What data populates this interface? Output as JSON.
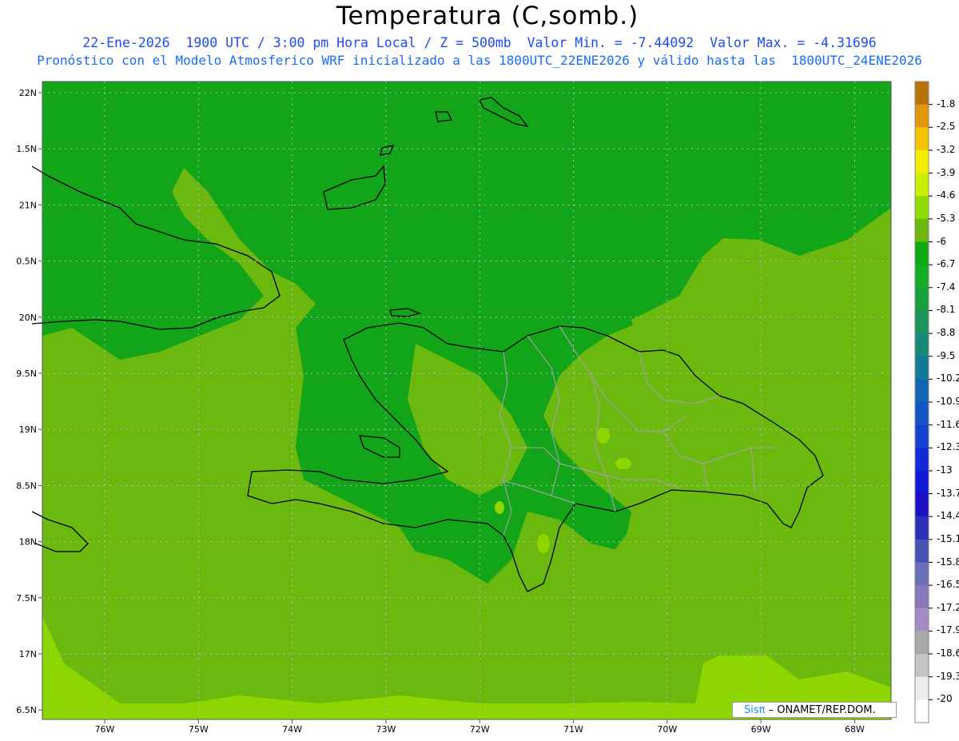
{
  "header": {
    "title": "Temperatura (C,somb.)",
    "subtitle_line1": "22-Ene-2026  1900 UTC / 3:00 pm Hora Local / Z = 500mb  Valor Min. = -7.44092  Valor Max. = -4.31696",
    "subtitle_line2": "Pronóstico con el Modelo Atmosferico WRF inicializado a las 1800UTC_22ENE2026 y válido hasta las  1800UTC_24ENE2026"
  },
  "axes": {
    "lon_labels": [
      "76W",
      "75W",
      "74W",
      "73W",
      "72W",
      "71W",
      "70W",
      "69W",
      "68W"
    ],
    "lat_labels": [
      "22N",
      "1.5N",
      "21N",
      "0.5N",
      "20N",
      "9.5N",
      "19N",
      "8.5N",
      "18N",
      "7.5N",
      "17N",
      "6.5N"
    ]
  },
  "colorbar": {
    "labels": [
      "-1.8",
      "-2.5",
      "-3.2",
      "-3.9",
      "-4.6",
      "-5.3",
      "-6",
      "-6.7",
      "-7.4",
      "-8.1",
      "-8.8",
      "-9.5",
      "-10.2",
      "-10.9",
      "-11.6",
      "-12.3",
      "-13",
      "-13.7",
      "-14.4",
      "-15.1",
      "-15.8",
      "-16.5",
      "-17.2",
      "-17.9",
      "-18.6",
      "-19.3",
      "-20"
    ],
    "colors": [
      "#b8730b",
      "#e2960a",
      "#f5c200",
      "#f6ee00",
      "#c8f000",
      "#8edb00",
      "#6cb80c",
      "#0fa810",
      "#14ad25",
      "#17a03a",
      "#1a9557",
      "#15887a",
      "#127a98",
      "#1266b0",
      "#1455c6",
      "#1440d0",
      "#1328d6",
      "#1018d6",
      "#1a10c8",
      "#2e2eb8",
      "#4a50b4",
      "#6a70b8",
      "#8a78bc",
      "#a48cc4",
      "#a8a8a8",
      "#c4c4c4",
      "#ececec"
    ]
  },
  "field_colors": {
    "dark_green": "#12a519",
    "mid_green": "#6bb80f",
    "light_green": "#8ed600",
    "yellow_green": "#c6ee00"
  },
  "credit": {
    "brand": "Sisπ",
    "text": " – ONAMET/REP.DOM."
  }
}
